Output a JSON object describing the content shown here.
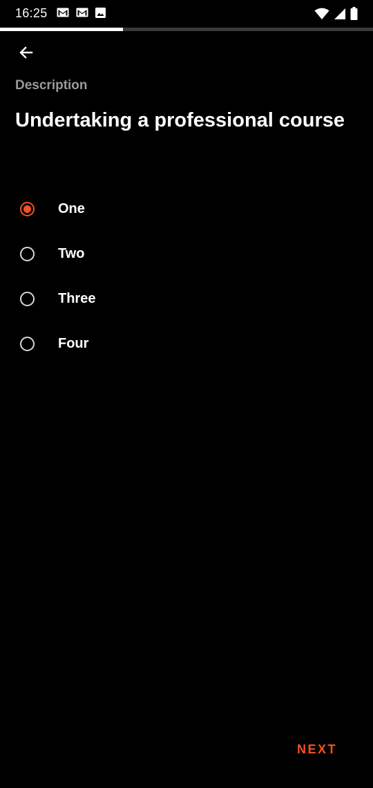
{
  "status_bar": {
    "time": "16:25",
    "left_icons": [
      "gmail-icon",
      "gmail-icon",
      "image-icon"
    ],
    "right_icons": [
      "wifi-icon",
      "cellular-signal-icon",
      "battery-icon"
    ]
  },
  "progress": {
    "fraction": 0.33,
    "track_color": "#3a3a3a",
    "fill_color": "#ffffff"
  },
  "header": {
    "back_icon": "arrow-back-icon",
    "eyebrow": "Description",
    "title": "Undertaking a professional course"
  },
  "options": [
    {
      "label": "One",
      "selected": true
    },
    {
      "label": "Two",
      "selected": false
    },
    {
      "label": "Three",
      "selected": false
    },
    {
      "label": "Four",
      "selected": false
    }
  ],
  "footer": {
    "next_label": "NEXT"
  },
  "colors": {
    "accent": "#f4511e",
    "background": "#000000",
    "muted_text": "#9a9a9a"
  }
}
